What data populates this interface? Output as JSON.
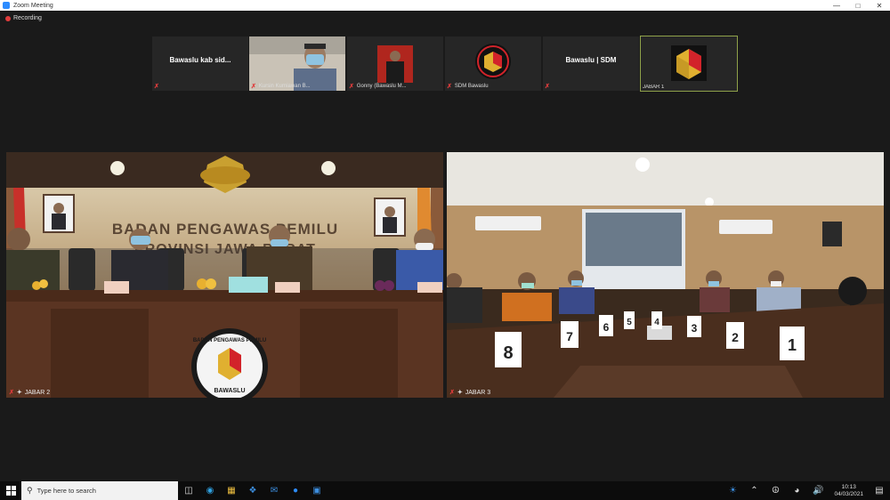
{
  "window": {
    "title": "Zoom Meeting"
  },
  "recording": {
    "label": "Recording"
  },
  "thumbnails": [
    {
      "display_name": "Bawaslu kab sid...",
      "label": ""
    },
    {
      "display_name": "",
      "label": "Kursin Kurniawan B..."
    },
    {
      "display_name": "",
      "label": "Gonny (Bawaslu M..."
    },
    {
      "display_name": "",
      "label": "SDM Bawaslu"
    },
    {
      "display_name": "Bawaslu | SDM",
      "label": ""
    },
    {
      "display_name": "",
      "label": "JABAR 1"
    }
  ],
  "videos": [
    {
      "label": "JABAR 2",
      "wall_text_1": "BADAN PENGAWAS PEMILU",
      "wall_text_2": "PROVINSI JAWA BARAT",
      "logo_text_top": "BADAN PENGAWAS PEMILU",
      "logo_text_bottom": "BAWASLU"
    },
    {
      "label": "JABAR 3",
      "table_numbers": [
        "8",
        "7",
        "6",
        "5",
        "4",
        "3",
        "2",
        "1"
      ]
    }
  ],
  "taskbar": {
    "search_placeholder": "Type here to search",
    "time": "10:13",
    "date": "04/03/2021"
  },
  "colors": {
    "accent": "#2d8cff",
    "mic_muted": "#e03c3c",
    "active_border": "#8fa24a",
    "bawaslu_red": "#d2232a"
  }
}
